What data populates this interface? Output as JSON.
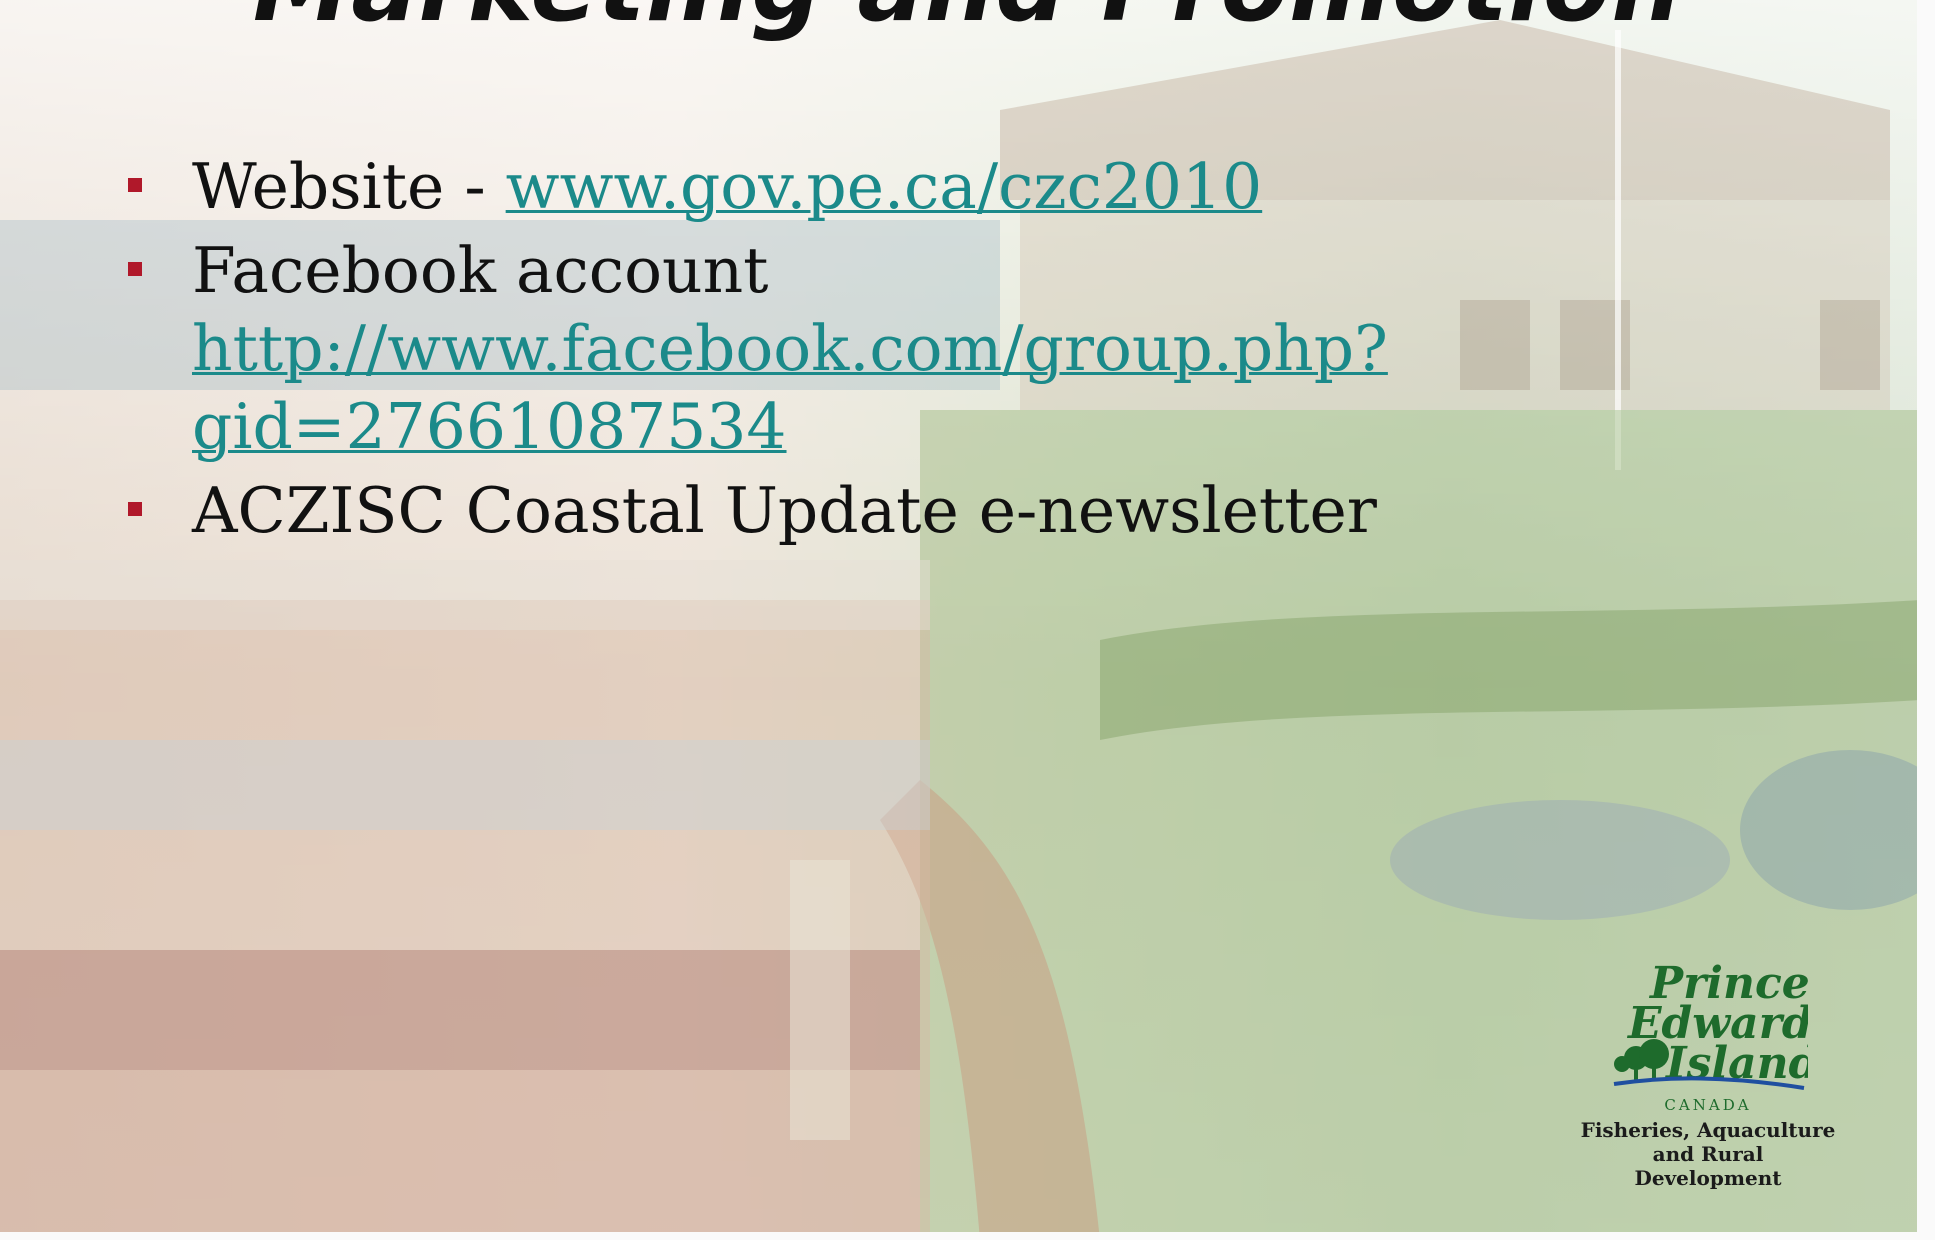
{
  "slide": {
    "title": "Marketing and Promotion",
    "bullets": [
      {
        "prefix": "Website - ",
        "link": "www.gov.pe.ca/czc2010"
      },
      {
        "text": "Facebook account",
        "link": "http://www.facebook.com/group.php?gid=27661087534"
      },
      {
        "text": "ACZISC Coastal Update e-newsletter"
      }
    ]
  },
  "logo": {
    "line1": "Prince",
    "line2": "Edward",
    "line3": "Island",
    "country": "CANADA",
    "dept_line1": "Fisheries, Aquaculture",
    "dept_line2": "and Rural Development"
  },
  "colors": {
    "bullet_marker": "#b0182a",
    "link": "#1b8a8a",
    "logo_green": "#1e6b2c",
    "logo_blue": "#1f4fa0"
  }
}
